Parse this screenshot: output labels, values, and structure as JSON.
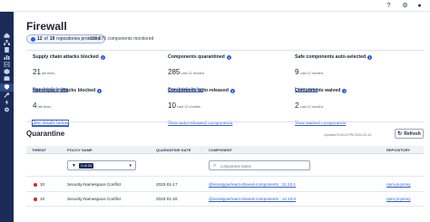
{
  "topbar": {
    "icons": [
      {
        "name": "help-icon",
        "glyph": "?"
      },
      {
        "name": "gear-icon",
        "glyph": "⚙"
      },
      {
        "name": "user-icon",
        "glyph": "●"
      }
    ]
  },
  "sidebar": {
    "icons": [
      "home-icon",
      "hierarchy-icon",
      "document-icon",
      "reports-icon",
      "policy-icon",
      "components-icon",
      "database-icon",
      "shield-icon",
      "wrench-icon",
      "bolt-icon",
      "settings-icon"
    ],
    "active_index": 7
  },
  "header": {
    "title": "Firewall",
    "repos_prefix": "12",
    "repos_of": "of",
    "repos_total": "19",
    "repos_suffix": "repositories protected",
    "components_monitored": "156,675 components monitored"
  },
  "metrics": [
    {
      "title": "Supply chain attacks blocked",
      "value": "21",
      "sub": "(all time)",
      "link": "See details below"
    },
    {
      "title": "Components quarantined",
      "value": "285",
      "sub": "Last 12 months",
      "link": "See details below"
    },
    {
      "title": "Safe components auto-selected",
      "value": "9",
      "sub": "Last 12 months",
      "link": "Learn more"
    },
    {
      "title": "Namespace attacks blocked",
      "value": "4",
      "sub": "(all time)",
      "link": "See details below"
    },
    {
      "title": "Components auto-released",
      "value": "10",
      "sub": "Last 12 months",
      "link": "View auto-released components"
    },
    {
      "title": "Components waived",
      "value": "2",
      "sub": "Last 12 months",
      "link": "View waived components"
    }
  ],
  "quarantine": {
    "title": "Quarantine",
    "updated": "Updated 5:46:43 PM 2024-03-14",
    "refresh_label": "Refresh",
    "columns": [
      "THREAT",
      "POLICY NAME",
      "QUARANTINE DATE",
      "COMPONENT",
      "REPOSITORY"
    ],
    "filter_count": "1 of 24",
    "search_placeholder": "component name",
    "rows": [
      {
        "threat": "10",
        "policy": "Security-Namespace Conflict",
        "date": "2023-01-17",
        "component": "@sonatype/react-shared-components : 12.10.1",
        "repository": "npm-js-proxy"
      },
      {
        "threat": "10",
        "policy": "Security-Namespace Conflict",
        "date": "2023-01-18",
        "component": "@sonatype/react-shared-components : 12.10.0",
        "repository": "npm-js-proxy"
      }
    ]
  },
  "colors": {
    "nav_bg": "#1a2b57",
    "accent": "#2f5fd6",
    "threat": "#d1242f"
  }
}
